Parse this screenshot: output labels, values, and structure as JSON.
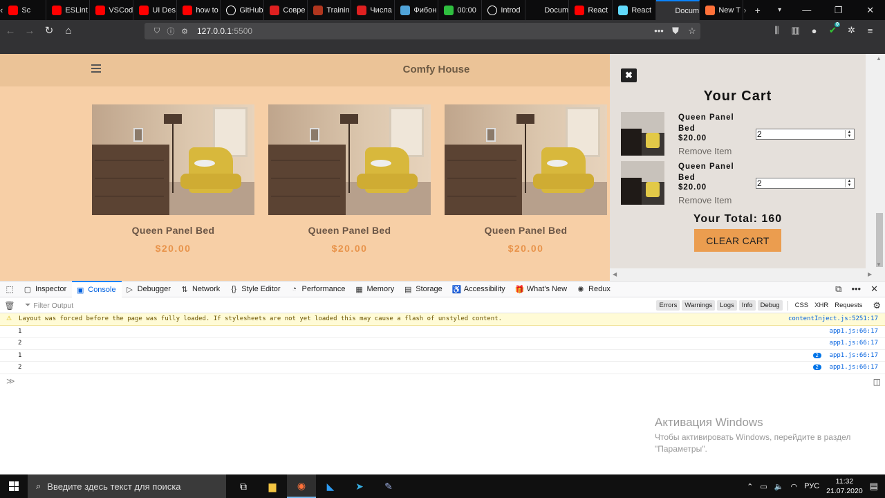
{
  "browser": {
    "tabs": [
      {
        "title": "Sc",
        "icon": "youtube-icon",
        "color": "#ff0000"
      },
      {
        "title": "ESLint",
        "icon": "youtube-icon",
        "color": "#ff0000"
      },
      {
        "title": "VSCode",
        "icon": "youtube-icon",
        "color": "#ff0000"
      },
      {
        "title": "UI Des",
        "icon": "youtube-icon",
        "color": "#ff0000"
      },
      {
        "title": "how to",
        "icon": "youtube-icon",
        "color": "#ff0000"
      },
      {
        "title": "GitHub",
        "icon": "github-icon",
        "color": "#ffffff"
      },
      {
        "title": "Совре",
        "icon": "javascript-info-icon",
        "color": "#e02020"
      },
      {
        "title": "Trainin",
        "icon": "codewars-icon",
        "color": "#b1361e"
      },
      {
        "title": "Числа",
        "icon": "javascript-info-icon",
        "color": "#e02020"
      },
      {
        "title": "Фибон",
        "icon": "puzzle-icon",
        "color": "#4fa3d9"
      },
      {
        "title": "00:00",
        "icon": "timer-icon",
        "color": "#2fbf3f"
      },
      {
        "title": "Introd",
        "icon": "github-icon",
        "color": "#ffffff"
      },
      {
        "title": "Document",
        "icon": "",
        "color": ""
      },
      {
        "title": "React",
        "icon": "youtube-icon",
        "color": "#ff0000"
      },
      {
        "title": "React",
        "icon": "react-icon",
        "color": "#61dafb"
      },
      {
        "title": "Docum",
        "icon": "",
        "color": "",
        "active": true
      },
      {
        "title": "New T",
        "icon": "firefox-icon",
        "color": "#ff7139"
      }
    ],
    "url_host": "127.0.0.1",
    "url_port": ":5500",
    "extension_badge": "0"
  },
  "site": {
    "brand": "Comfy House",
    "products": [
      {
        "name": "Queen Panel Bed",
        "price": "$20.00"
      },
      {
        "name": "Queen Panel Bed",
        "price": "$20.00"
      },
      {
        "name": "Queen Panel Bed",
        "price": "$20.00"
      }
    ]
  },
  "cart": {
    "title": "Your Cart",
    "items": [
      {
        "name": "Queen Panel Bed",
        "price": "$20.00",
        "remove_label": "Remove Item",
        "qty": "2"
      },
      {
        "name": "Queen Panel Bed",
        "price": "$20.00",
        "remove_label": "Remove Item",
        "qty": "2"
      }
    ],
    "total_label": "Your Total: 160",
    "clear_label": "CLEAR CART"
  },
  "devtools": {
    "tabs": [
      {
        "label": "Inspector",
        "icon": "inspector-icon"
      },
      {
        "label": "Console",
        "icon": "console-icon",
        "active": true
      },
      {
        "label": "Debugger",
        "icon": "debugger-icon"
      },
      {
        "label": "Network",
        "icon": "network-icon"
      },
      {
        "label": "Style Editor",
        "icon": "style-editor-icon"
      },
      {
        "label": "Performance",
        "icon": "performance-icon"
      },
      {
        "label": "Memory",
        "icon": "memory-icon"
      },
      {
        "label": "Storage",
        "icon": "storage-icon"
      },
      {
        "label": "Accessibility",
        "icon": "accessibility-icon"
      },
      {
        "label": "What's New",
        "icon": "gift-icon"
      },
      {
        "label": "Redux",
        "icon": "redux-icon"
      }
    ],
    "filter_placeholder": "Filter Output",
    "filter_buttons": [
      "Errors",
      "Warnings",
      "Logs",
      "Info",
      "Debug"
    ],
    "filter_plain": [
      "CSS",
      "XHR",
      "Requests"
    ],
    "messages": [
      {
        "type": "warning",
        "text": "Layout was forced before the page was fully loaded. If stylesheets are not yet loaded this may cause a flash of unstyled content.",
        "source": "contentInject.js:5251:17"
      },
      {
        "type": "log",
        "text": "1",
        "source": "app1.js:66:17"
      },
      {
        "type": "log",
        "text": "2",
        "source": "app1.js:66:17"
      },
      {
        "type": "log",
        "text": "1",
        "source": "app1.js:66:17",
        "repeat": "2"
      },
      {
        "type": "log",
        "text": "2",
        "source": "app1.js:66:17",
        "repeat": "2"
      }
    ]
  },
  "watermark": {
    "title": "Активация Windows",
    "line1": "Чтобы активировать Windows, перейдите в раздел",
    "line2": "\"Параметры\"."
  },
  "taskbar": {
    "search_placeholder": "Введите здесь текст для поиска",
    "language": "РУС",
    "time": "11:32",
    "date": "21.07.2020"
  }
}
